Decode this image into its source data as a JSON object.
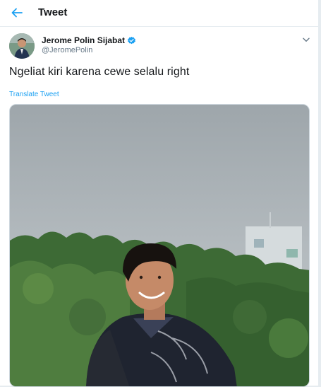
{
  "header": {
    "title": "Tweet",
    "back_icon": "arrow-left-icon"
  },
  "tweet": {
    "author": {
      "display_name": "Jerome Polin Sijabat",
      "handle": "@JeromePolin",
      "verified": true
    },
    "text": "Ngeliat kiri karena cewe selalu right",
    "translate_label": "Translate Tweet",
    "menu_icon": "chevron-down-icon"
  },
  "colors": {
    "accent": "#1da1f2",
    "text": "#14171a",
    "secondary": "#657786"
  }
}
